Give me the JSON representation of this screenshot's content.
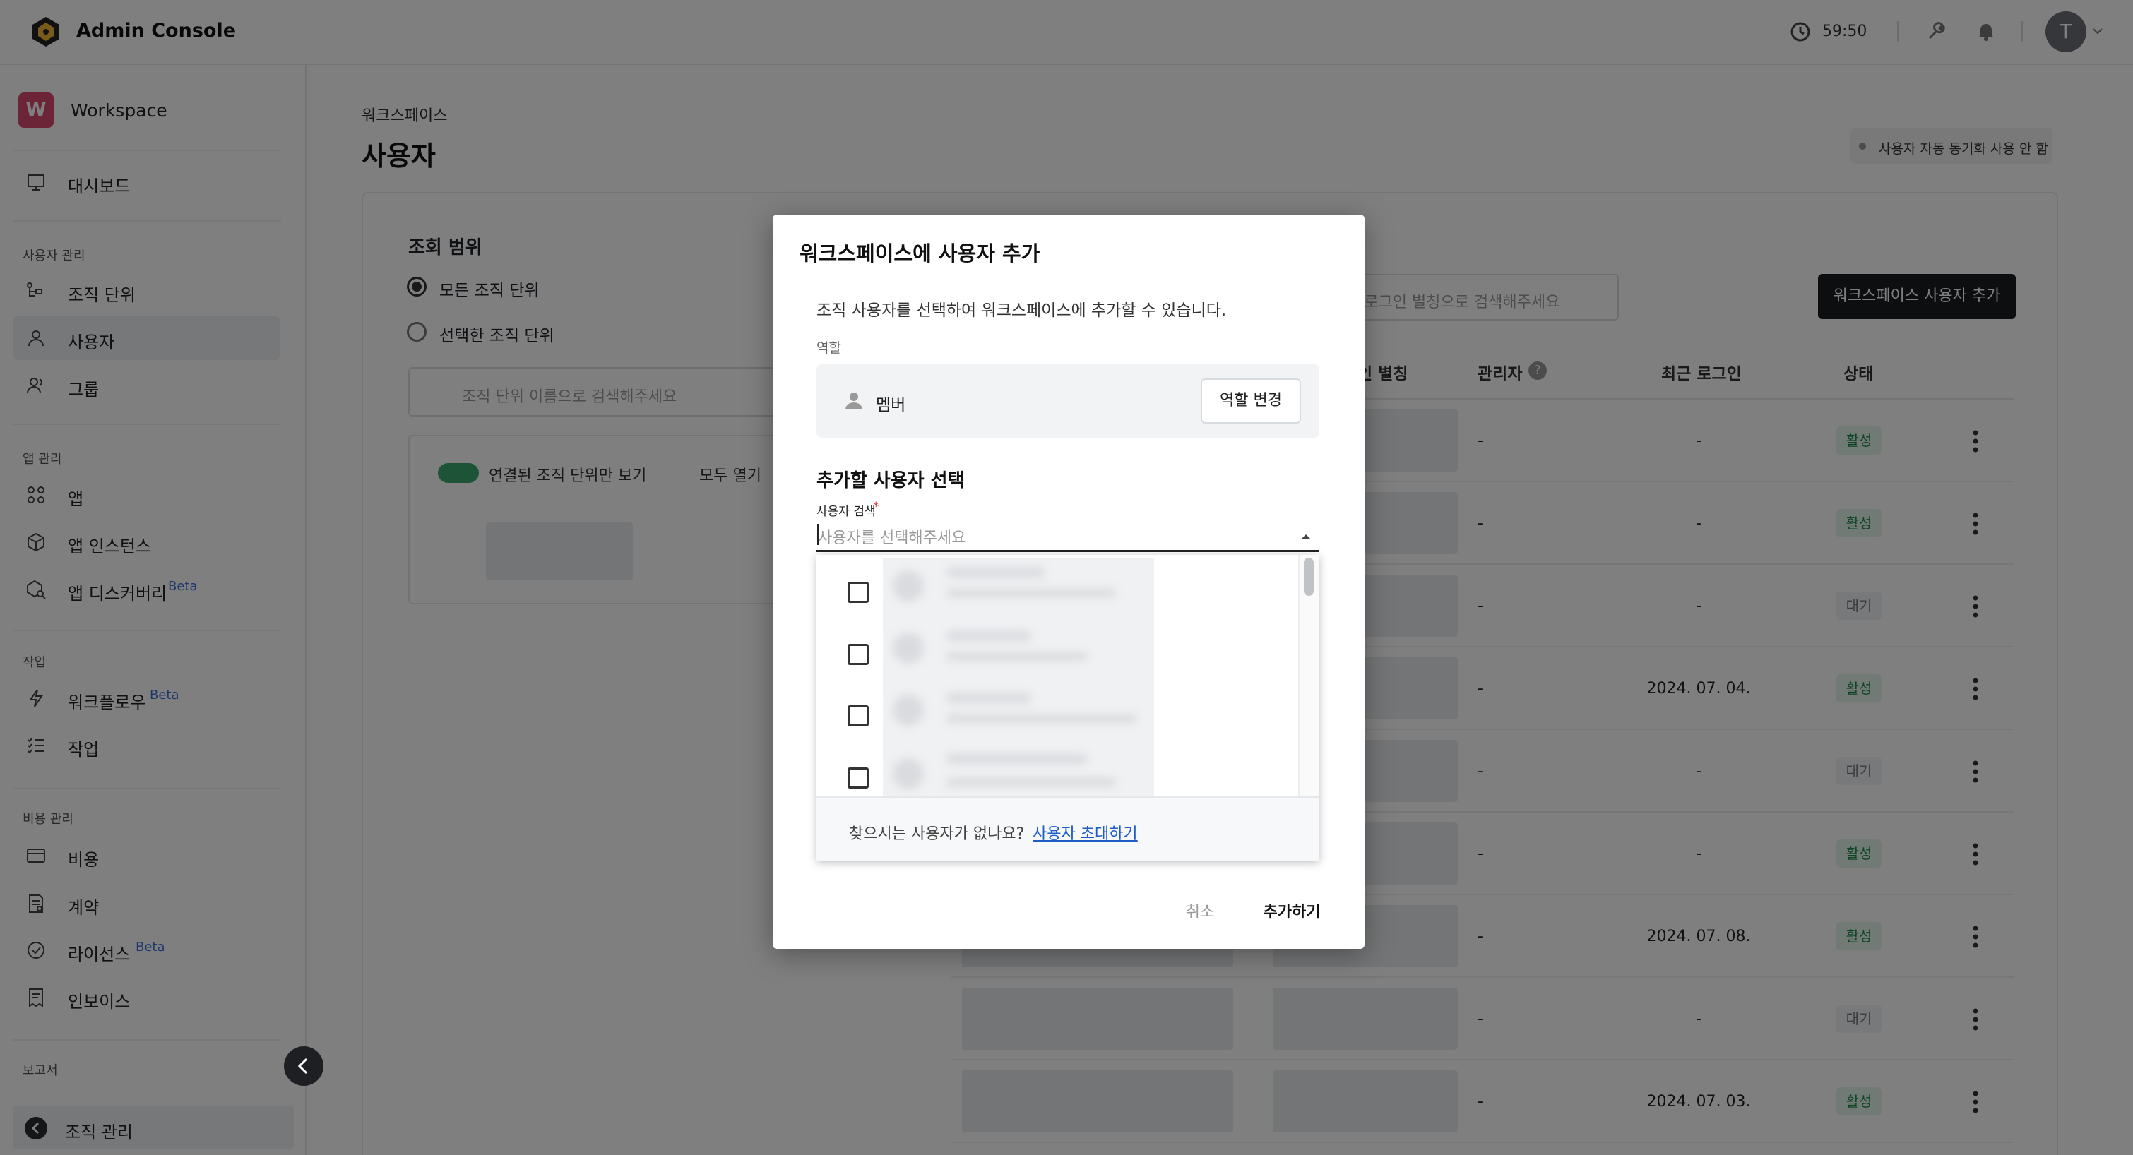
{
  "header": {
    "app_title": "Admin Console",
    "timer": "59:50",
    "avatar_initial": "T"
  },
  "sidebar": {
    "workspace_initial": "W",
    "workspace_name": "Workspace",
    "dashboard": "대시보드",
    "sections": {
      "user_mgmt": "사용자 관리",
      "app_mgmt": "앱 관리",
      "jobs": "작업",
      "cost_mgmt": "비용 관리",
      "report": "보고서"
    },
    "items": {
      "org_unit": "조직 단위",
      "users": "사용자",
      "group": "그룹",
      "app": "앱",
      "app_instance": "앱 인스턴스",
      "app_discovery": "앱 디스커버리",
      "workflow": "워크플로우",
      "job": "작업",
      "cost": "비용",
      "contract": "계약",
      "license": "라이선스",
      "invoice": "인보이스",
      "org_mgmt": "조직 관리"
    },
    "beta": "Beta"
  },
  "main": {
    "breadcrumb": "워크스페이스",
    "title": "사용자",
    "sync_status": "사용자 자동 동기화 사용 안 함",
    "scope_title": "조회 범위",
    "scope_all": "모든 조직 단위",
    "scope_selected": "선택한 조직 단위",
    "org_search_placeholder": "조직 단위 이름으로 검색해주세요",
    "linked_only": "연결된 조직 단위만 보기",
    "expand_all": "모두 열기",
    "alias_search_placeholder": "는 로그인 별칭으로 검색해주세요",
    "add_user_button": "워크스페이스 사용자 추가",
    "columns": {
      "alias": "인 별칭",
      "admin": "관리자",
      "last_login": "최근 로그인",
      "status": "상태"
    },
    "rows": [
      {
        "admin": "-",
        "last_login": "-",
        "status": "활성"
      },
      {
        "admin": "-",
        "last_login": "-",
        "status": "활성"
      },
      {
        "admin": "-",
        "last_login": "-",
        "status": "대기"
      },
      {
        "admin": "-",
        "last_login": "2024. 07. 04.",
        "status": "활성"
      },
      {
        "admin": "-",
        "last_login": "-",
        "status": "대기"
      },
      {
        "admin": "-",
        "last_login": "-",
        "status": "활성"
      },
      {
        "admin": "-",
        "last_login": "2024. 07. 08.",
        "status": "활성"
      },
      {
        "admin": "-",
        "last_login": "-",
        "status": "대기"
      },
      {
        "admin": "-",
        "last_login": "2024. 07. 03.",
        "status": "활성"
      }
    ]
  },
  "modal": {
    "title": "워크스페이스에 사용자 추가",
    "description": "조직 사용자를 선택하여 워크스페이스에 추가할 수 있습니다.",
    "role_label": "역할",
    "role_value": "멤버",
    "role_change": "역할 변경",
    "select_title": "추가할 사용자 선택",
    "search_label": "사용자 검색",
    "required_mark": "*",
    "search_placeholder": "사용자를 선택해주세요",
    "not_found": "찾으시는 사용자가 없나요?",
    "invite_link": "사용자 초대하기",
    "cancel": "취소",
    "confirm": "추가하기"
  },
  "colors": {
    "accent_dark": "#1a1c1f",
    "workspace_badge": "#d9486f",
    "link": "#1f5bc9",
    "status_active": "#1f8a4c",
    "required": "#d3312c"
  }
}
